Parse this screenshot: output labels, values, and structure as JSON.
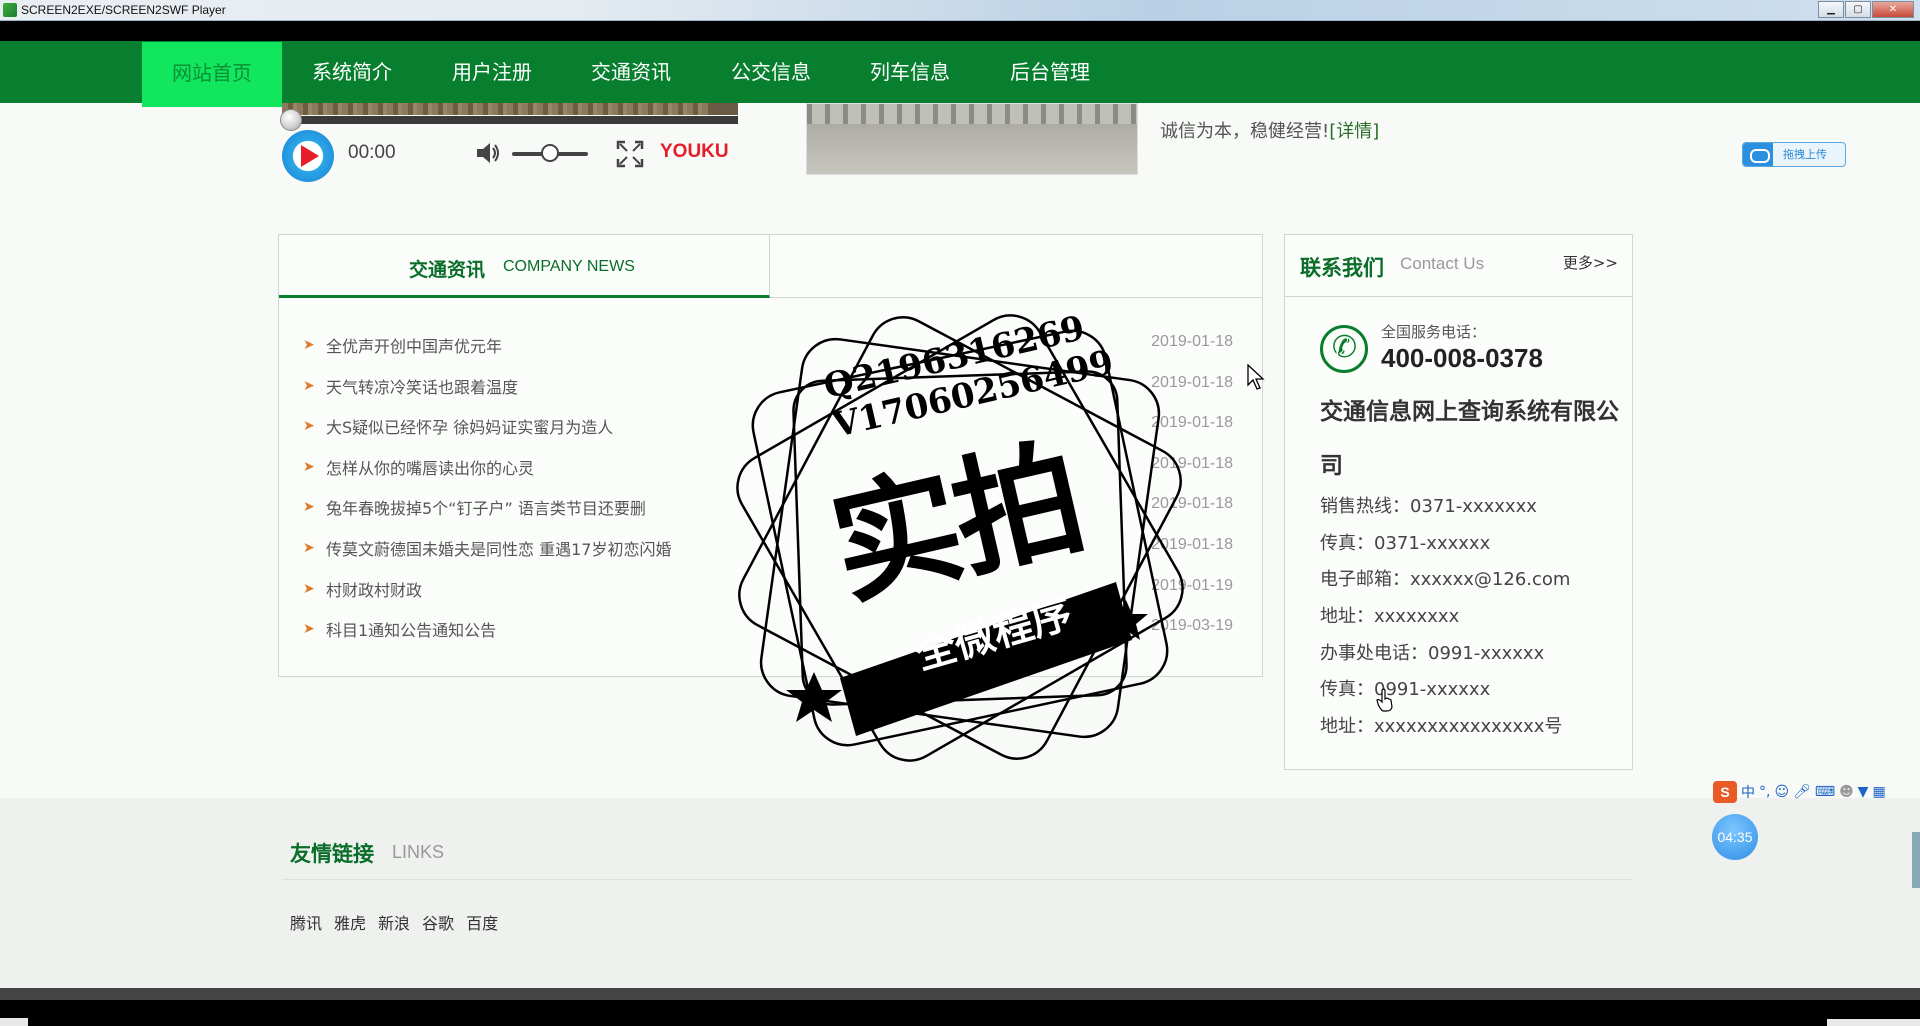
{
  "window": {
    "title": "SCREEN2EXE/SCREEN2SWF Player",
    "minimize": "▁",
    "maximize": "▢",
    "close": "✕"
  },
  "nav": {
    "items": [
      {
        "label": "网站首页",
        "active": true
      },
      {
        "label": "系统简介"
      },
      {
        "label": "用户注册"
      },
      {
        "label": "交通资讯"
      },
      {
        "label": "公交信息"
      },
      {
        "label": "列车信息"
      },
      {
        "label": "后台管理"
      }
    ]
  },
  "player": {
    "time": "00:00",
    "brand": "YOUKU",
    "icons": [
      "play-icon",
      "volume-icon",
      "fullscreen-icon"
    ]
  },
  "intro": {
    "text": "诚信为本，稳健经营!",
    "link": "[详情]"
  },
  "upload": {
    "label": "拖拽上传"
  },
  "news": {
    "tab_title": "交通资讯",
    "tab_subtitle": "COMPANY NEWS",
    "items": [
      {
        "title": "全优声开创中国声优元年",
        "date": "2019-01-18"
      },
      {
        "title": "天气转凉冷笑话也跟着温度",
        "date": "2019-01-18"
      },
      {
        "title": "大S疑似已经怀孕 徐妈妈证实蜜月为造人",
        "date": "2019-01-18"
      },
      {
        "title": "怎样从你的嘴唇读出你的心灵",
        "date": "2019-01-18"
      },
      {
        "title": "兔年春晚拔掉5个“钉子户” 语言类节目还要删",
        "date": "2019-01-18"
      },
      {
        "title": "传莫文蔚德国未婚夫是同性恋 重遇17岁初恋闪婚",
        "date": "2019-01-18"
      },
      {
        "title": "村财政村财政",
        "date": "2019-01-19"
      },
      {
        "title": "科目1通知公告通知公告",
        "date": "2019-03-19"
      }
    ]
  },
  "contact": {
    "title": "联系我们",
    "subtitle": "Contact Us",
    "more": "更多>>",
    "service_label": "全国服务电话：",
    "service_number": "400-008-0378",
    "company": "交通信息网上查询系统有限公司",
    "lines": [
      "销售热线：0371-xxxxxxx",
      "传真：0371-xxxxxx",
      "电子邮箱：xxxxxx@126.com",
      "地址：xxxxxxxx",
      "办事处电话：0991-xxxxxx",
      "传真：0991-xxxxxx",
      "地址：xxxxxxxxxxxxxxxx号"
    ]
  },
  "links": {
    "title": "友情链接",
    "subtitle": "LINKS",
    "items": [
      "腾讯",
      "雅虎",
      "新浪",
      "谷歌",
      "百度"
    ]
  },
  "watermark": {
    "line1": "Q2196316269",
    "line2": "V17060256499",
    "big": "实拍",
    "ribbon": "全微程序"
  },
  "ime": {
    "logo": "S",
    "mode": "中",
    "punct": "°,",
    "icons": [
      "emoji-icon",
      "mic-icon",
      "keyboard-icon",
      "user-icon",
      "shirt-icon",
      "grid-icon"
    ]
  },
  "recorder": {
    "time": "04:35"
  },
  "colors": {
    "nav_bg": "#087f2f",
    "nav_active": "#11e65e",
    "accent_green": "#0a6d2a",
    "arrow": "#e07b2a"
  }
}
